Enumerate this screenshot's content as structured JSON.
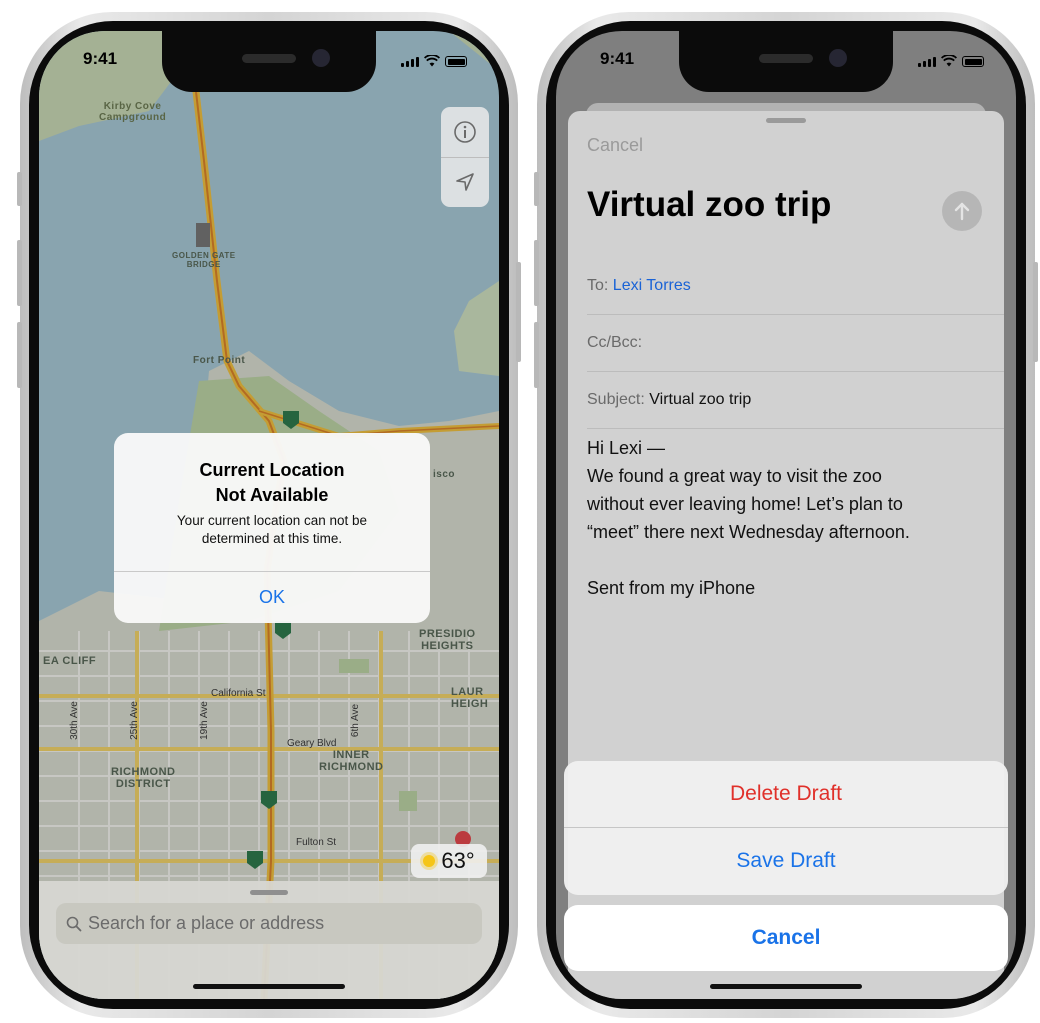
{
  "phone1": {
    "status": {
      "time": "9:41"
    },
    "map": {
      "labels": {
        "kirby_cove": "Kirby Cove\nCampground",
        "golden_gate": "GOLDEN GATE\nBRIDGE",
        "fort_point": "Fort Point",
        "presidio": "PRESIDIO\nHEIGHTS",
        "sea_cliff": "EA CLIFF",
        "richmond": "RICHMOND\nDISTRICT",
        "inner_richmond": "INNER\nRICHMOND",
        "laurel": "LAUR\nHEIGH",
        "sf_partial": "isco"
      },
      "streets": {
        "california": "California St",
        "geary": "Geary Blvd",
        "fulton": "Fulton St",
        "ave30": "30th Ave",
        "ave25": "25th Ave",
        "ave19": "19th Ave",
        "ave6": "6th Ave"
      },
      "route_shield": "1"
    },
    "controls": {
      "info_icon": "info-icon",
      "location_icon": "location-arrow-icon"
    },
    "alert": {
      "title_line1": "Current Location",
      "title_line2": "Not Available",
      "message": "Your current location can not be determined at this time.",
      "ok_label": "OK"
    },
    "weather": {
      "temperature": "63°",
      "icon": "sun-icon"
    },
    "search": {
      "placeholder": "Search for a place or address",
      "icon": "search-icon"
    }
  },
  "phone2": {
    "status": {
      "time": "9:41"
    },
    "compose": {
      "cancel_label": "Cancel",
      "title": "Virtual zoo trip",
      "send_icon": "arrow-up-icon",
      "to_label": "To:",
      "to_value": "Lexi Torres",
      "cc_label": "Cc/Bcc:",
      "subject_label": "Subject:",
      "subject_value": "Virtual zoo trip",
      "body": {
        "greeting": "Hi Lexi —",
        "line1": "We found a great way to visit the zoo",
        "line2": "without ever leaving home! Let’s plan to",
        "line3": "“meet” there next Wednesday afternoon.",
        "signature": "Sent from my iPhone"
      }
    },
    "action_sheet": {
      "delete_label": "Delete Draft",
      "save_label": "Save Draft",
      "cancel_label": "Cancel"
    }
  },
  "colors": {
    "ios_blue": "#1a73e8",
    "destructive_red": "#e0302a"
  }
}
